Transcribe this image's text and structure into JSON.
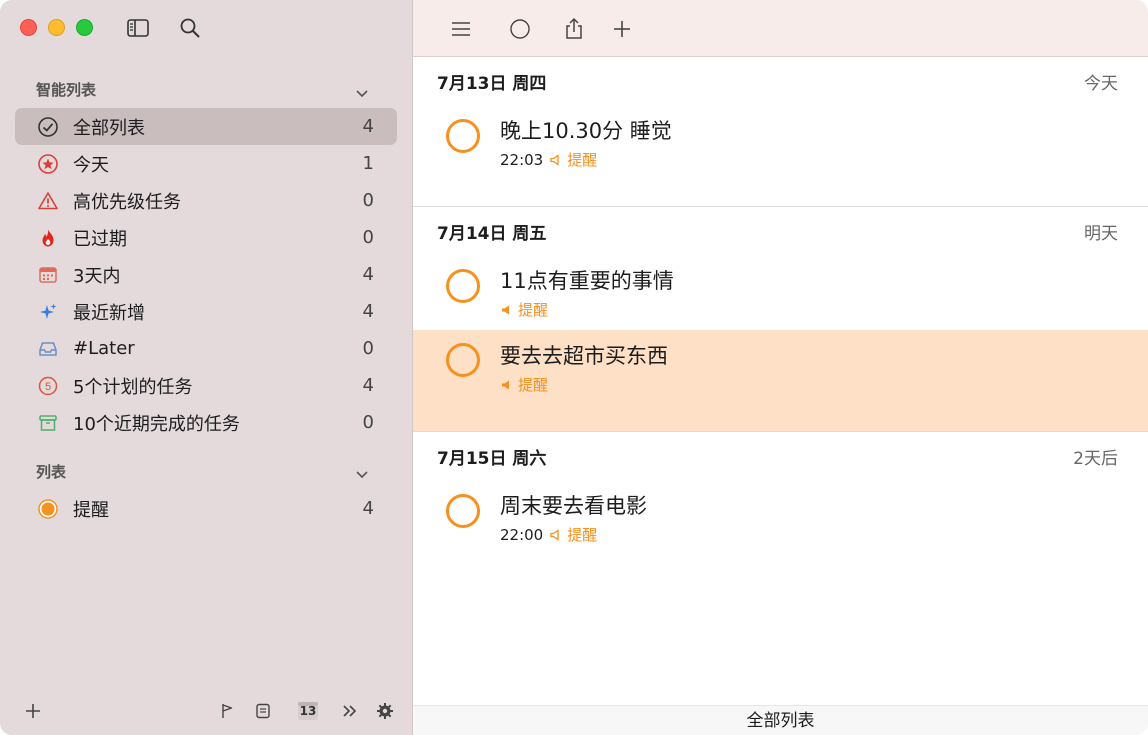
{
  "sidebar": {
    "smart_header": "智能列表",
    "smart_items": [
      {
        "label": "全部列表",
        "count": "4",
        "icon": "checkmark-circle-icon"
      },
      {
        "label": "今天",
        "count": "1",
        "icon": "star-circle-icon"
      },
      {
        "label": "高优先级任务",
        "count": "0",
        "icon": "warning-triangle-icon"
      },
      {
        "label": "已过期",
        "count": "0",
        "icon": "flame-icon"
      },
      {
        "label": "3天内",
        "count": "4",
        "icon": "calendar-icon"
      },
      {
        "label": "最近新增",
        "count": "4",
        "icon": "sparkles-icon"
      },
      {
        "label": "#Later",
        "count": "0",
        "icon": "inbox-tray-icon"
      },
      {
        "label": "5个计划的任务",
        "count": "4",
        "icon": "number-five-circle-icon"
      },
      {
        "label": "10个近期完成的任务",
        "count": "0",
        "icon": "archive-box-icon"
      }
    ],
    "lists_header": "列表",
    "lists_items": [
      {
        "label": "提醒",
        "count": "4",
        "icon": "orange-dot-icon"
      }
    ],
    "calendar_day": "13"
  },
  "main": {
    "groups": [
      {
        "date": "7月13日 周四",
        "relative": "今天"
      },
      {
        "date": "7月14日 周五",
        "relative": "明天"
      },
      {
        "date": "7月15日 周六",
        "relative": "2天后"
      }
    ],
    "tasks": [
      {
        "title": "晚上10.30分 睡觉",
        "time": "22:03",
        "remind": "提醒"
      },
      {
        "title": "11点有重要的事情",
        "time": "",
        "remind": "提醒"
      },
      {
        "title": "要去去超市买东西",
        "time": "",
        "remind": "提醒"
      },
      {
        "title": "周末要去看电影",
        "time": "22:00",
        "remind": "提醒"
      }
    ],
    "status": "全部列表"
  },
  "colors": {
    "accent": "#f7901e",
    "highlight": "#fde0c5",
    "sidebar_bg": "#e4dadb",
    "selected": "#c9bebd"
  }
}
